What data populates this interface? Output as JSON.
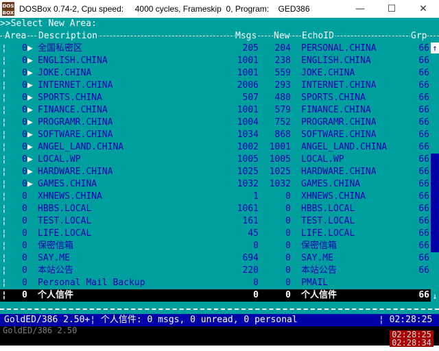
{
  "window": {
    "title": "DOSBox 0.74-2, Cpu speed:     4000 cycles, Frameskip  0, Program:    GED386",
    "icon_label_top": "DOS",
    "icon_label_bottom": "BOX",
    "minimize": "—",
    "maximize": "☐",
    "close": "✕"
  },
  "prompt": ">>Select New Area:",
  "columns": {
    "area": "Area",
    "description": "Description",
    "msgs": "Msgs",
    "new": "New",
    "echoid": "EchoID",
    "grp": "Grp"
  },
  "rows": [
    {
      "area": "0",
      "pointer": "▶",
      "description": "全国私密区",
      "msgs": "205",
      "new": "204",
      "echoid": "PERSONAL.CHINA",
      "grp": "66"
    },
    {
      "area": "0",
      "pointer": "▶",
      "description": "ENGLISH.CHINA",
      "msgs": "1001",
      "new": "238",
      "echoid": "ENGLISH.CHINA",
      "grp": "66"
    },
    {
      "area": "0",
      "pointer": "▶",
      "description": "JOKE.CHINA",
      "msgs": "1001",
      "new": "559",
      "echoid": "JOKE.CHINA",
      "grp": "66"
    },
    {
      "area": "0",
      "pointer": "▶",
      "description": "INTERNET.CHINA",
      "msgs": "2006",
      "new": "293",
      "echoid": "INTERNET.CHINA",
      "grp": "66"
    },
    {
      "area": "0",
      "pointer": "▶",
      "description": "SPORTS.CHINA",
      "msgs": "507",
      "new": "480",
      "echoid": "SPORTS.CHINA",
      "grp": "66"
    },
    {
      "area": "0",
      "pointer": "▶",
      "description": "FINANCE.CHINA",
      "msgs": "1001",
      "new": "579",
      "echoid": "FINANCE.CHINA",
      "grp": "66"
    },
    {
      "area": "0",
      "pointer": "▶",
      "description": "PROGRAMR.CHINA",
      "msgs": "1004",
      "new": "752",
      "echoid": "PROGRAMR.CHINA",
      "grp": "66"
    },
    {
      "area": "0",
      "pointer": "▶",
      "description": "SOFTWARE.CHINA",
      "msgs": "1034",
      "new": "868",
      "echoid": "SOFTWARE.CHINA",
      "grp": "66"
    },
    {
      "area": "0",
      "pointer": "▶",
      "description": "ANGEL_LAND.CHINA",
      "msgs": "1002",
      "new": "1001",
      "echoid": "ANGEL_LAND.CHINA",
      "grp": "66"
    },
    {
      "area": "0",
      "pointer": "▶",
      "description": "LOCAL.WP",
      "msgs": "1005",
      "new": "1005",
      "echoid": "LOCAL.WP",
      "grp": "66"
    },
    {
      "area": "0",
      "pointer": "▶",
      "description": "HARDWARE.CHINA",
      "msgs": "1025",
      "new": "1025",
      "echoid": "HARDWARE.CHINA",
      "grp": "66"
    },
    {
      "area": "0",
      "pointer": "▶",
      "description": "GAMES.CHINA",
      "msgs": "1032",
      "new": "1032",
      "echoid": "GAMES.CHINA",
      "grp": "66"
    },
    {
      "area": "0",
      "pointer": "",
      "description": "XHNEWS.CHINA",
      "msgs": "1",
      "new": "0",
      "echoid": "XHNEWS.CHINA",
      "grp": "66"
    },
    {
      "area": "0",
      "pointer": "",
      "description": "HBBS.LOCAL",
      "msgs": "1061",
      "new": "0",
      "echoid": "HBBS.LOCAL",
      "grp": "66"
    },
    {
      "area": "0",
      "pointer": "",
      "description": "TEST.LOCAL",
      "msgs": "161",
      "new": "0",
      "echoid": "TEST.LOCAL",
      "grp": "66"
    },
    {
      "area": "0",
      "pointer": "",
      "description": "LIFE.LOCAL",
      "msgs": "45",
      "new": "0",
      "echoid": "LIFE.LOCAL",
      "grp": "66"
    },
    {
      "area": "0",
      "pointer": "",
      "description": "保密信箱",
      "msgs": "0",
      "new": "0",
      "echoid": "保密信箱",
      "grp": "66"
    },
    {
      "area": "0",
      "pointer": "",
      "description": "SAY.ME",
      "msgs": "694",
      "new": "0",
      "echoid": "SAY.ME",
      "grp": "66"
    },
    {
      "area": "0",
      "pointer": "",
      "description": "本站公告",
      "msgs": "220",
      "new": "0",
      "echoid": "本站公告",
      "grp": "66"
    },
    {
      "area": "0",
      "pointer": "",
      "description": "Personal Mail Backup",
      "msgs": "0",
      "new": "0",
      "echoid": "PMAIL",
      "grp": ""
    },
    {
      "area": "0",
      "pointer": "",
      "description": "个人信件",
      "msgs": "0",
      "new": "0",
      "echoid": "个人信件",
      "grp": "66"
    }
  ],
  "selected_row_index": 20,
  "scrollbar": {
    "up": "↑",
    "down": "↓"
  },
  "status": {
    "left": "GoldED/386 2.50+¦ 个人信件: 0 msgs, 0 unread, 0 personal",
    "time": "¦ 02:28:25"
  },
  "residue": {
    "text": "GoldED/386 2.50",
    "clock1": "02:28:25",
    "clock2": "02:28:34"
  },
  "colors": {
    "screen_bg": "#009f9f",
    "text_blue": "#0000b0",
    "status_bg": "#0000a8",
    "selected_bg": "#000000"
  }
}
